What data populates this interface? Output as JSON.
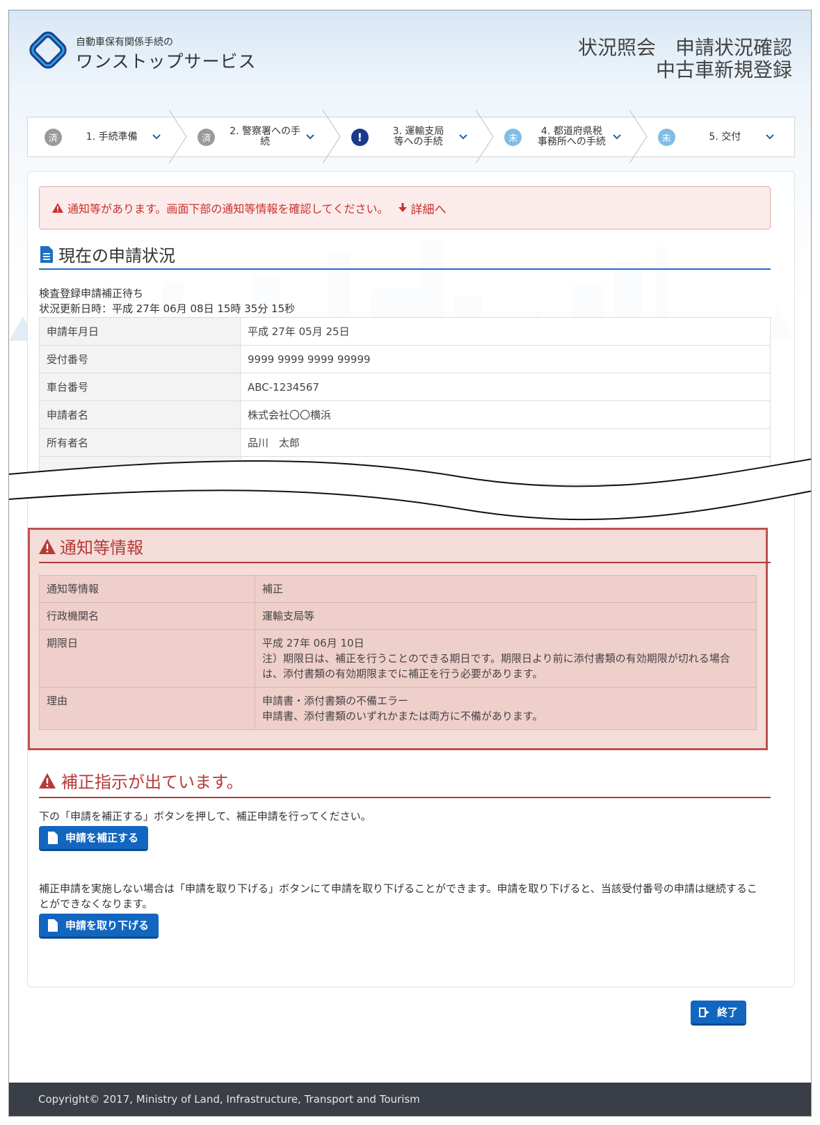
{
  "brand": {
    "sub": "自動車保有関係手続の",
    "main": "ワンストップサービス"
  },
  "page_title": {
    "line1": "状況照会　申請状況確認",
    "line2": "中古車新規登録"
  },
  "steps": [
    {
      "badge": "済",
      "label": "1. 手続準備",
      "state": "done"
    },
    {
      "badge": "済",
      "label": "2. 警察署への手続",
      "state": "done"
    },
    {
      "badge": "!",
      "label": "3. 運輸支局等への手続",
      "state": "alert"
    },
    {
      "badge": "未",
      "label": "4. 都道府県税事務所への手続",
      "state": "todo"
    },
    {
      "badge": "未",
      "label": "5. 交付",
      "state": "todo"
    }
  ],
  "alert": {
    "message": "通知等があります。画面下部の通知等情報を確認してください。",
    "link": "詳細へ"
  },
  "status_section": {
    "title": "現在の申請状況",
    "status": "検査登録申請補正待ち",
    "updated": "状況更新日時：平成 27年 06月 08日 15時 35分 15秒",
    "rows": [
      {
        "key": "申請年月日",
        "value": "平成 27年 05月 25日"
      },
      {
        "key": "受付番号",
        "value": "9999 9999 9999 99999"
      },
      {
        "key": "車台番号",
        "value": "ABC-1234567"
      },
      {
        "key": "申請者名",
        "value": "株式会社〇〇横浜"
      },
      {
        "key": "所有者名",
        "value": "品川　太郎"
      }
    ]
  },
  "notice_section": {
    "title": "通知等情報",
    "rows": [
      {
        "key": "通知等情報",
        "value": "補正"
      },
      {
        "key": "行政機関名",
        "value": "運輸支局等"
      },
      {
        "key": "期限日",
        "value": "平成 27年 06月 10日",
        "note": "注）期限日は、補正を行うことのできる期日です。期限日より前に添付書類の有効期限が切れる場合は、添付書類の有効期限までに補正を行う必要があります。"
      },
      {
        "key": "理由",
        "value": "申請書・添付書類の不備エラー",
        "note": "申請書、添付書類のいずれかまたは両方に不備があります。"
      }
    ]
  },
  "correction": {
    "title": "補正指示が出ています。",
    "instruction": "下の「申請を補正する」ボタンを押して、補正申請を行ってください。",
    "correct_button": "申請を補正する",
    "withdraw_text": "補正申請を実施しない場合は「申請を取り下げる」ボタンにて申請を取り下げることができます。申請を取り下げると、当該受付番号の申請は継続することができなくなります。",
    "withdraw_button": "申請を取り下げる"
  },
  "exit_button": "終了",
  "footer": "Copyright© 2017, Ministry of Land, Infrastructure, Transport and Tourism",
  "colors": {
    "accent_blue": "#1266c0",
    "alert_red": "#c9302c",
    "notice_border": "#c0504d",
    "footer_bg": "#3a3f47"
  }
}
